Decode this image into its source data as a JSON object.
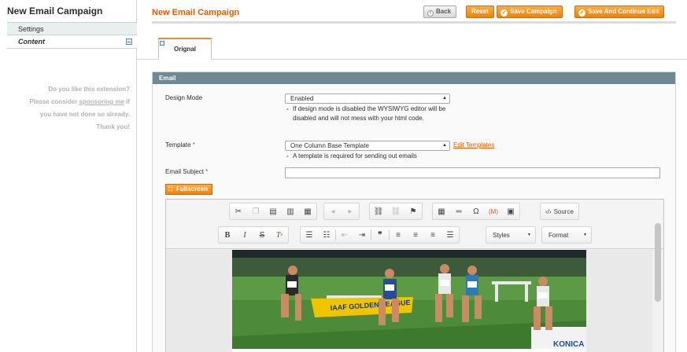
{
  "sidebar": {
    "title": "New Email Campaign",
    "tabs": [
      {
        "label": "Settings"
      },
      {
        "label": "Content"
      }
    ],
    "sponsor": {
      "line1": "Do you like this extension?",
      "line2_before": "Please consider ",
      "line2_link": "sponsoring me",
      "line2_after": " if",
      "line3": "you have not done so already.",
      "line4": "Thank you!"
    }
  },
  "header": {
    "title": "New Email Campaign",
    "buttons": {
      "back": "Back",
      "reset": "Reset",
      "save": "Save Campaign",
      "save_continue": "Save And Continue Edit"
    }
  },
  "content_tab": {
    "label": "Orignal"
  },
  "form": {
    "section_title": "Email",
    "design_mode": {
      "label": "Design Mode",
      "value": "Enabled",
      "note": "If design mode is disabled the WYSIWYG editor will be disabled and will not mess with your html code."
    },
    "template": {
      "label": "Template",
      "required": "*",
      "value": "One Column Base Template",
      "edit_link": "Edit Templates",
      "note": "A template is required for sending out emails"
    },
    "subject": {
      "label": "Email Subject",
      "required": "*",
      "value": ""
    },
    "fullscreen_button": "Fullscreen"
  },
  "editor": {
    "source_label": "Source",
    "styles_label": "Styles",
    "format_label": "Format",
    "icons_row1": [
      "cut-icon",
      "copy-icon",
      "paste-icon",
      "paste-text-icon",
      "paste-word-icon",
      "undo-icon",
      "redo-icon",
      "link-icon",
      "unlink-icon",
      "anchor-icon",
      "table-icon",
      "horizontal-rule-icon",
      "special-char-icon",
      "magento-widget-icon",
      "image-icon"
    ],
    "icons_row2": [
      "bold-icon",
      "italic-icon",
      "strike-icon",
      "remove-format-icon",
      "numbered-list-icon",
      "bullet-list-icon",
      "outdent-icon",
      "indent-icon",
      "blockquote-icon",
      "align-left-icon",
      "align-center-icon",
      "align-right-icon",
      "justify-icon"
    ]
  },
  "colors": {
    "accent": "#eb5e00",
    "button_orange": "#f18200",
    "section_header": "#6f8992"
  }
}
